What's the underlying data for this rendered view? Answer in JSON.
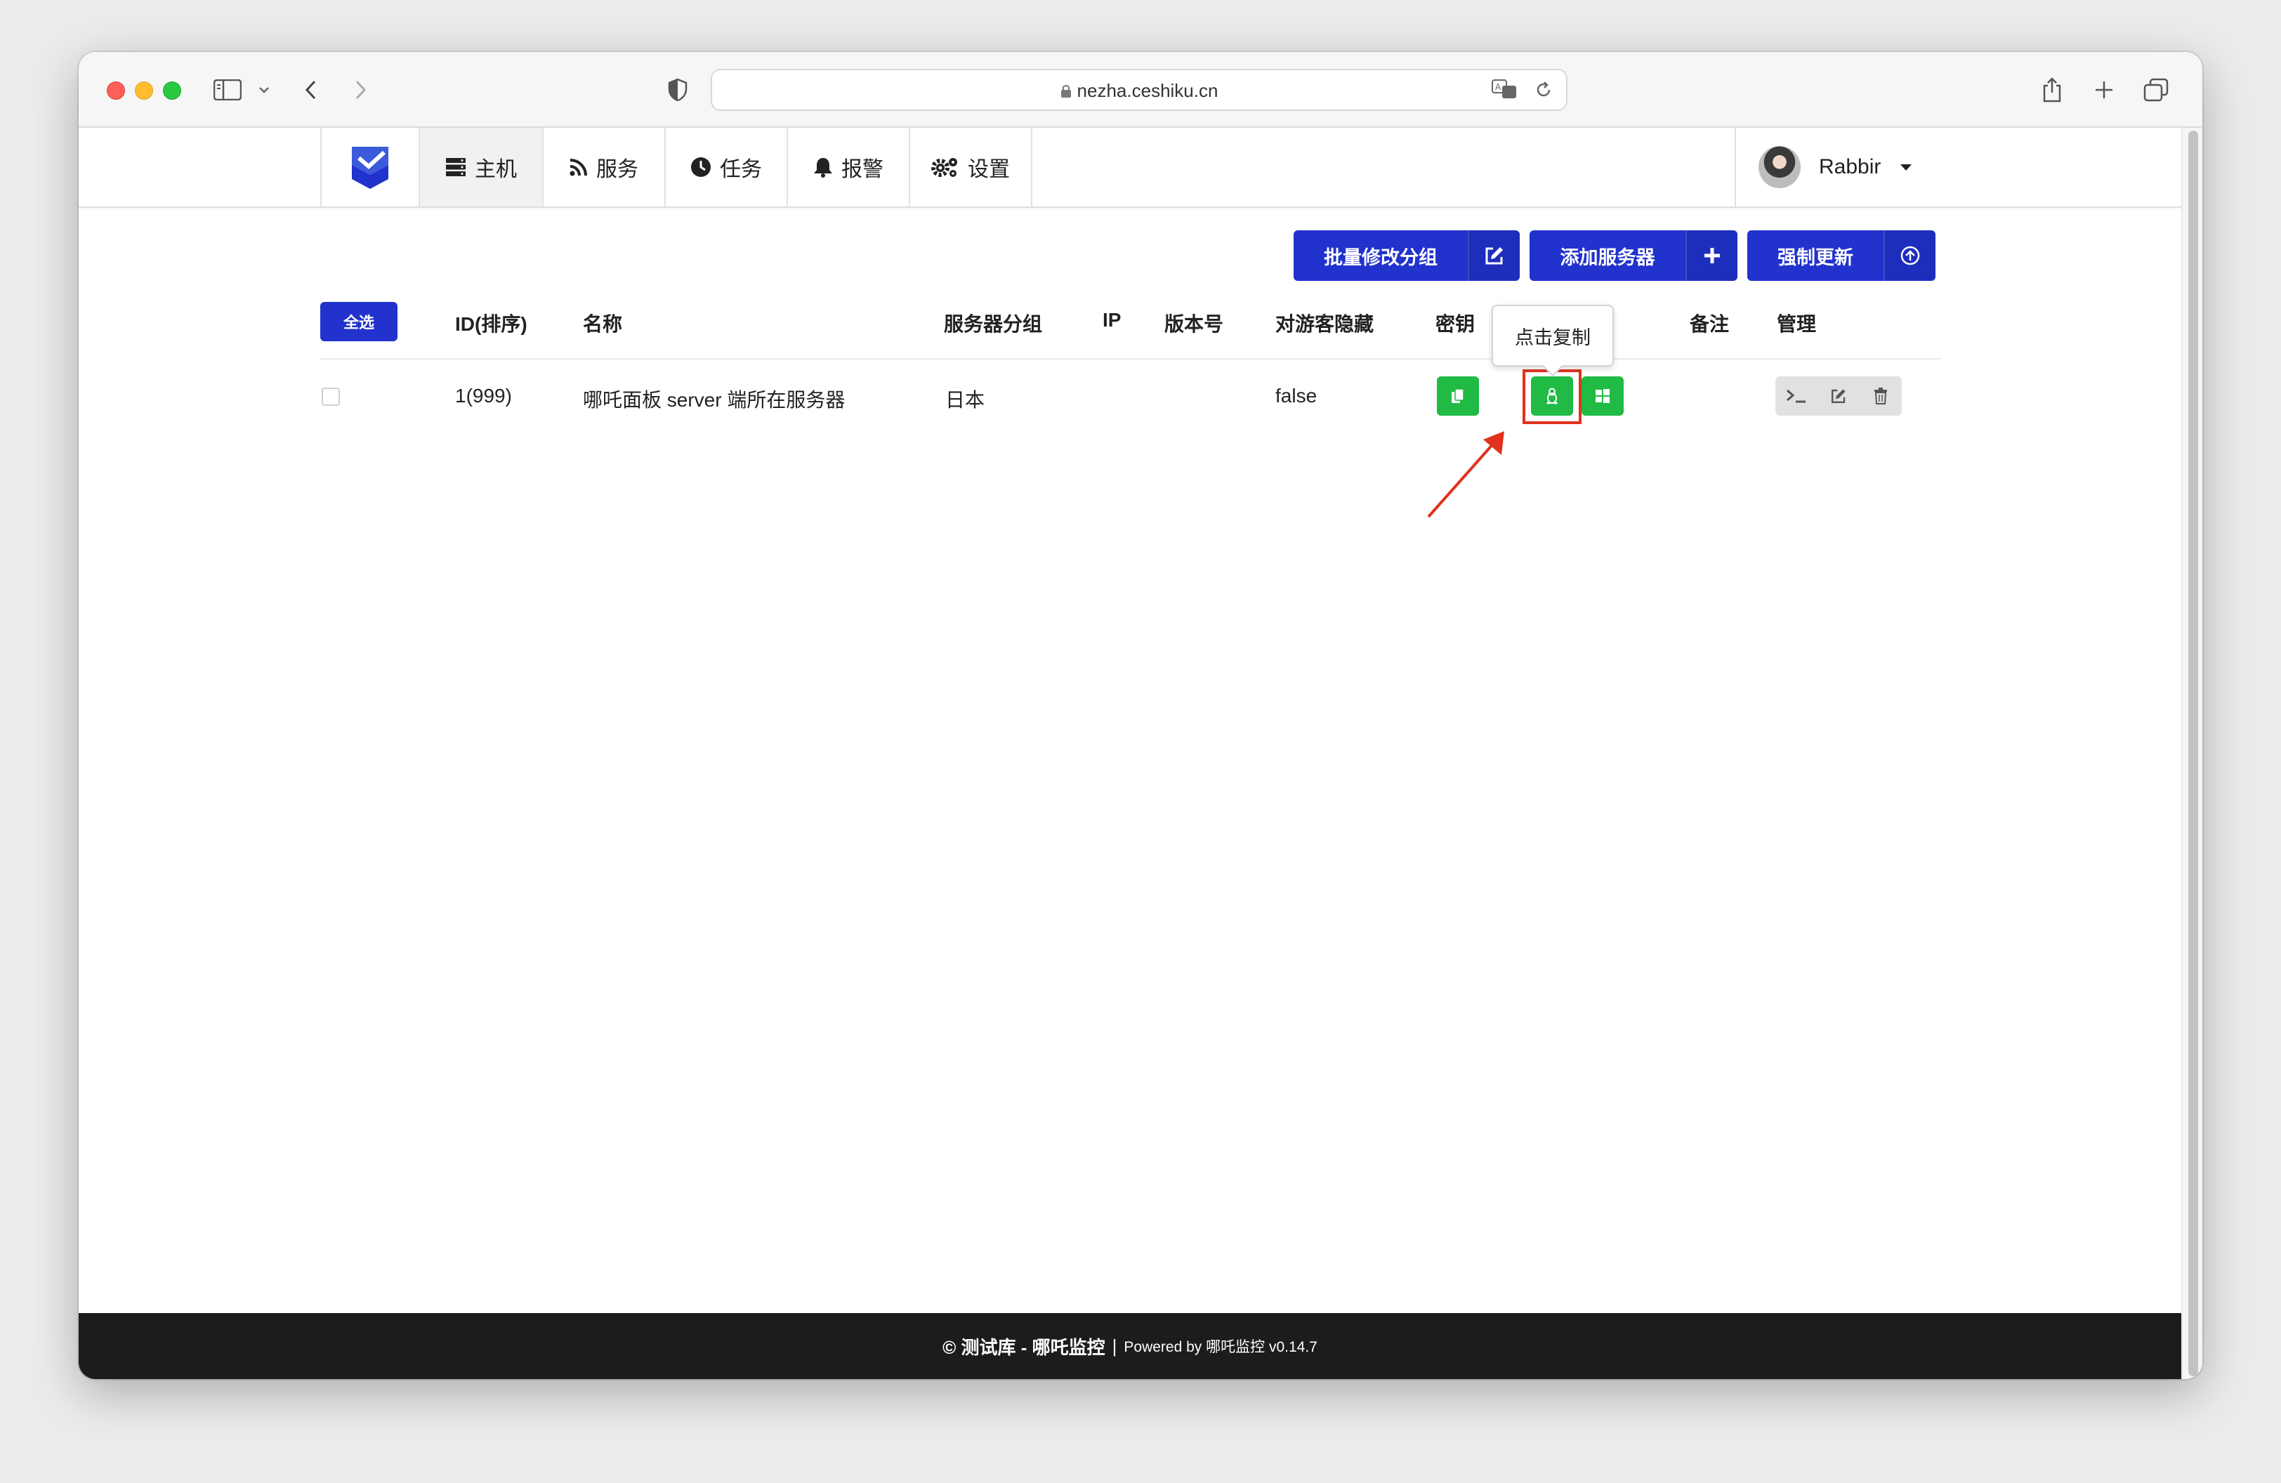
{
  "browser": {
    "url": "nezha.ceshiku.cn"
  },
  "nav": {
    "items": [
      {
        "label": "主机",
        "icon": "server-icon",
        "active": true
      },
      {
        "label": "服务",
        "icon": "rss-icon",
        "active": false
      },
      {
        "label": "任务",
        "icon": "clock-icon",
        "active": false
      },
      {
        "label": "报警",
        "icon": "bell-icon",
        "active": false
      },
      {
        "label": "设置",
        "icon": "cogs-icon",
        "active": false
      }
    ],
    "user": "Rabbir"
  },
  "toolbar": {
    "batch_group_label": "批量修改分组",
    "add_server_label": "添加服务器",
    "force_update_label": "强制更新"
  },
  "table": {
    "select_all_label": "全选",
    "headers": {
      "id": "ID(排序)",
      "name": "名称",
      "group": "服务器分组",
      "ip": "IP",
      "version": "版本号",
      "hide_guest": "对游客隐藏",
      "secret": "密钥",
      "note": "备注",
      "manage": "管理"
    },
    "rows": [
      {
        "id": "1(999)",
        "name": "哪吒面板 server 端所在服务器",
        "group": "日本",
        "ip": "",
        "version": "",
        "hide_guest": "false",
        "note": ""
      }
    ]
  },
  "tooltip": {
    "text": "点击复制"
  },
  "footer": {
    "brand": "© 测试库 - 哪吒监控",
    "powered": "Powered by 哪吒监控 v0.14.7"
  },
  "colors": {
    "primary": "#2132cd",
    "success": "#21ba45",
    "highlight": "#e0321c",
    "footer_bg": "#1b1c1d"
  }
}
